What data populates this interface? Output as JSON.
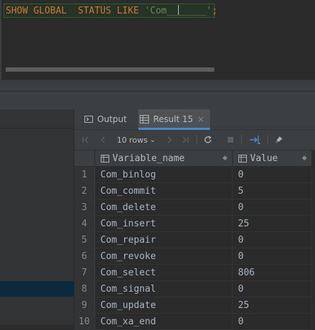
{
  "editor": {
    "sql_kw1": "SHOW",
    "sql_kw2": "GLOBAL",
    "sql_kw3": "STATUS",
    "sql_kw4": "LIKE",
    "sql_str_a": "'Com__",
    "sql_str_b": "_____'",
    "sql_end": ";"
  },
  "tabs": {
    "output_label": "Output",
    "result_label": "Result 15",
    "close_glyph": "×"
  },
  "toolbar": {
    "rows_label": "10 rows",
    "rows_caret": "⌄",
    "icons": [
      "first-page-icon",
      "prev-page-icon",
      "next-page-icon",
      "last-page-icon",
      "refresh-icon",
      "stop-icon",
      "transpose-icon",
      "pin-icon"
    ]
  },
  "table": {
    "columns": [
      "Variable_name",
      "Value"
    ],
    "rows": [
      {
        "n": "1",
        "name": "Com_binlog",
        "value": "0"
      },
      {
        "n": "2",
        "name": "Com_commit",
        "value": "5"
      },
      {
        "n": "3",
        "name": "Com_delete",
        "value": "0"
      },
      {
        "n": "4",
        "name": "Com_insert",
        "value": "25"
      },
      {
        "n": "5",
        "name": "Com_repair",
        "value": "0"
      },
      {
        "n": "6",
        "name": "Com_revoke",
        "value": "0"
      },
      {
        "n": "7",
        "name": "Com_select",
        "value": "806"
      },
      {
        "n": "8",
        "name": "Com_signal",
        "value": "0"
      },
      {
        "n": "9",
        "name": "Com_update",
        "value": "25"
      },
      {
        "n": "10",
        "name": "Com_xa_end",
        "value": "0"
      }
    ]
  },
  "colors": {
    "keyword": "#cc7832",
    "string": "#6a8759",
    "accent": "#4a88c7",
    "selection": "#0d293e"
  }
}
